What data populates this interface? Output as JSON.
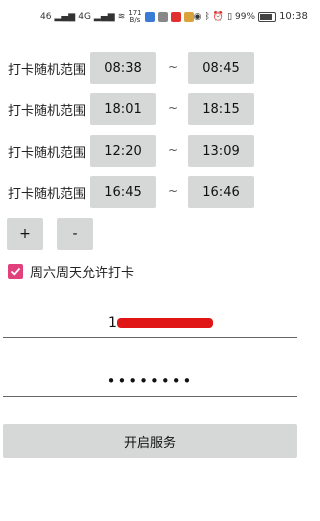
{
  "status_bar": {
    "signal_left": "46",
    "signal_right": "4G",
    "net_speed": "171",
    "net_unit": "B/s",
    "battery": "99%",
    "time": "10:38"
  },
  "rows": [
    {
      "label": "打卡随机范围",
      "start": "08:38",
      "sep": "~",
      "end": "08:45"
    },
    {
      "label": "打卡随机范围",
      "start": "18:01",
      "sep": "~",
      "end": "18:15"
    },
    {
      "label": "打卡随机范围",
      "start": "12:20",
      "sep": "~",
      "end": "13:09"
    },
    {
      "label": "打卡随机范围",
      "start": "16:45",
      "sep": "~",
      "end": "16:46"
    }
  ],
  "buttons": {
    "add": "+",
    "remove": "-",
    "start_service": "开启服务"
  },
  "weekend": {
    "label": "周六周天允许打卡",
    "checked": true
  },
  "account": {
    "visible_prefix": "1"
  },
  "password": {
    "masked": "••••••••"
  },
  "colors": {
    "accent": "#e0407b",
    "button_bg": "#d6d7d7",
    "redaction": "#e01515"
  }
}
